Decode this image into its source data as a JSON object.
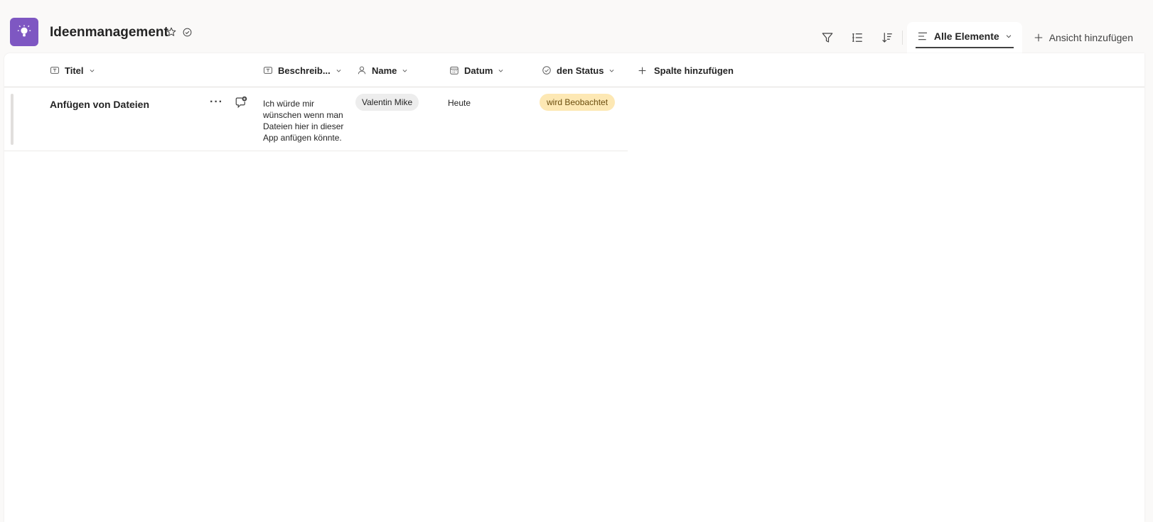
{
  "header": {
    "title": "Ideenmanagement",
    "app_icon": "lightbulb-icon",
    "accent_color": "#7e57c2"
  },
  "toolbar": {
    "view_label": "Alle Elemente",
    "add_view_label": "Ansicht hinzufügen"
  },
  "columns": {
    "title": "Titel",
    "description": "Beschreib...",
    "name": "Name",
    "date": "Datum",
    "status": "den Status",
    "add_column": "Spalte hinzufügen"
  },
  "rows": [
    {
      "title": "Anfügen von Dateien",
      "description": "Ich würde mir wünschen wenn man Dateien hier in dieser App anfügen könnte.",
      "name": "Valentin Mike",
      "date": "Heute",
      "status": "wird Beobachtet",
      "status_color": "#fde8b4"
    }
  ]
}
